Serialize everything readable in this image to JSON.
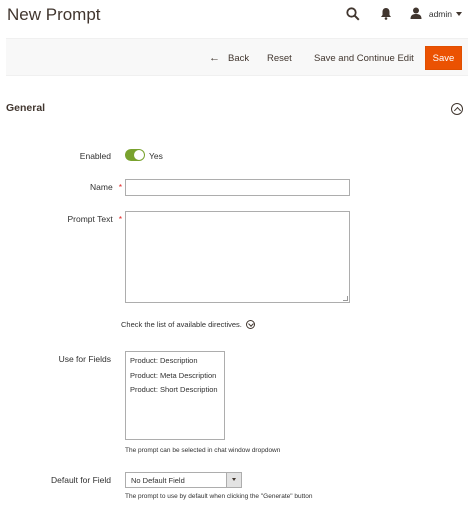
{
  "header": {
    "title": "New Prompt",
    "user_name": "admin"
  },
  "toolbar": {
    "back_label": "Back",
    "reset_label": "Reset",
    "continue_label": "Save and Continue Edit",
    "save_label": "Save"
  },
  "section": {
    "title": "General"
  },
  "form": {
    "enabled_label": "Enabled",
    "enabled_value": "Yes",
    "name_label": "Name",
    "name_value": "",
    "prompt_label": "Prompt Text",
    "prompt_value": "",
    "directives_text": "Check the list of available directives.",
    "use_for_label": "Use for Fields",
    "use_for_options": [
      "Product: Description",
      "Product: Meta Description",
      "Product: Short Description"
    ],
    "use_for_note": "The prompt can be selected in chat window dropdown",
    "default_label": "Default for Field",
    "default_value": "No Default Field",
    "default_note": "The prompt to use by default when clicking the \"Generate\" button",
    "required_marker": "*"
  },
  "colors": {
    "accent": "#eb5202",
    "toggle_on": "#79a22e",
    "required": "#e22626"
  }
}
